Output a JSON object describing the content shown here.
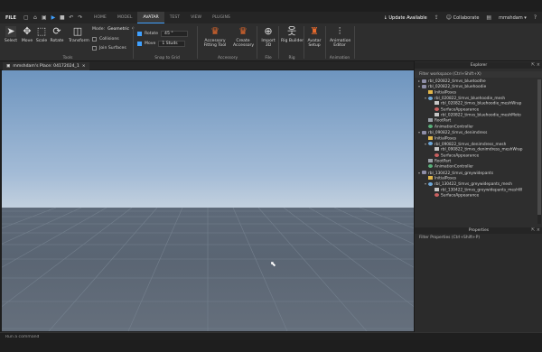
{
  "titlebar": {
    "file_label": "FILE",
    "tabs": [
      "HOME",
      "MODEL",
      "AVATAR",
      "TEST",
      "VIEW",
      "PLUGINS"
    ],
    "active_tab": "AVATAR",
    "update_label": "Update Available",
    "collaborate_label": "Collaborate",
    "username": "mmshdam"
  },
  "ribbon": {
    "tools": {
      "select": "Select",
      "move": "Move",
      "scale": "Scale",
      "rotate": "Rotate",
      "transform": "Transform"
    },
    "mode_label": "Mode:",
    "mode_value": "Geometric",
    "collisions_label": "Collisions",
    "join_surfaces_label": "Join Surfaces",
    "rotate_label": "Rotate",
    "rotate_value": "45 °",
    "move_label": "Move",
    "move_value": "1 Studs",
    "avatar_tools": {
      "accessory_fitting": "Accessory Fitting Tool",
      "create_accessory": "Create Accessory",
      "import_3d": "Import 3D",
      "rig_builder": "Rig Builder",
      "avatar_setup": "Avatar Setup",
      "animation_editor": "Animation Editor"
    },
    "groups": {
      "tools": "Tools",
      "snap_to_grid": "Snap to Grid",
      "accessory": "Accessory",
      "file": "File",
      "rig": "Rig",
      "animation": "Animation"
    }
  },
  "viewport": {
    "tab_label": "mmshdam's Place: 04172024_1"
  },
  "command_bar": {
    "placeholder": "Run a command"
  },
  "explorer": {
    "title": "Explorer",
    "filter_placeholder": "Filter workspace (Ctrl+Shift+X)",
    "items": [
      {
        "label": "rbl_020822_timvs_bluetoothe",
        "icon": "model",
        "depth": 1,
        "expanded": false
      },
      {
        "label": "rbl_020822_timvs_bluehoodie",
        "icon": "model",
        "depth": 1,
        "expanded": true
      },
      {
        "label": "InitialPoses",
        "icon": "folder",
        "depth": 2
      },
      {
        "label": "rbl_020822_timvs_bluehoodie_mesh",
        "icon": "mesh",
        "depth": 2,
        "expanded": true
      },
      {
        "label": "rbl_020822_timvs_bluehoodie_meshWrap",
        "icon": "wrap",
        "depth": 3
      },
      {
        "label": "SurfaceAppearance",
        "icon": "surf",
        "depth": 3
      },
      {
        "label": "rbl_020822_timvs_bluehoodie_meshMoto",
        "icon": "wrap",
        "depth": 3
      },
      {
        "label": "RootPart",
        "icon": "part",
        "depth": 2
      },
      {
        "label": "AnimationController",
        "icon": "anim",
        "depth": 2
      },
      {
        "label": "rbl_090822_timvs_denimdress",
        "icon": "model",
        "depth": 1,
        "expanded": true
      },
      {
        "label": "InitialPoses",
        "icon": "folder",
        "depth": 2
      },
      {
        "label": "rbl_090822_timvs_denimdress_mesh",
        "icon": "mesh",
        "depth": 2,
        "expanded": true
      },
      {
        "label": "rbl_090822_timvs_denimdress_meshWrap",
        "icon": "wrap",
        "depth": 3
      },
      {
        "label": "SurfaceAppearance",
        "icon": "surf",
        "depth": 3
      },
      {
        "label": "RootPart",
        "icon": "part",
        "depth": 2
      },
      {
        "label": "AnimationController",
        "icon": "anim",
        "depth": 2
      },
      {
        "label": "rbl_130422_timvs_greywidepants",
        "icon": "model",
        "depth": 1,
        "expanded": true
      },
      {
        "label": "InitialPoses",
        "icon": "folder",
        "depth": 2
      },
      {
        "label": "rbl_130422_timvs_greywidepants_mesh",
        "icon": "mesh",
        "depth": 2,
        "expanded": true
      },
      {
        "label": "rbl_130422_timvs_greywidepants_meshW",
        "icon": "wrap",
        "depth": 3
      },
      {
        "label": "SurfaceAppearance",
        "icon": "surf",
        "depth": 3
      }
    ]
  },
  "properties": {
    "title": "Properties",
    "filter_placeholder": "Filter Properties (Ctrl+Shift+P)"
  }
}
